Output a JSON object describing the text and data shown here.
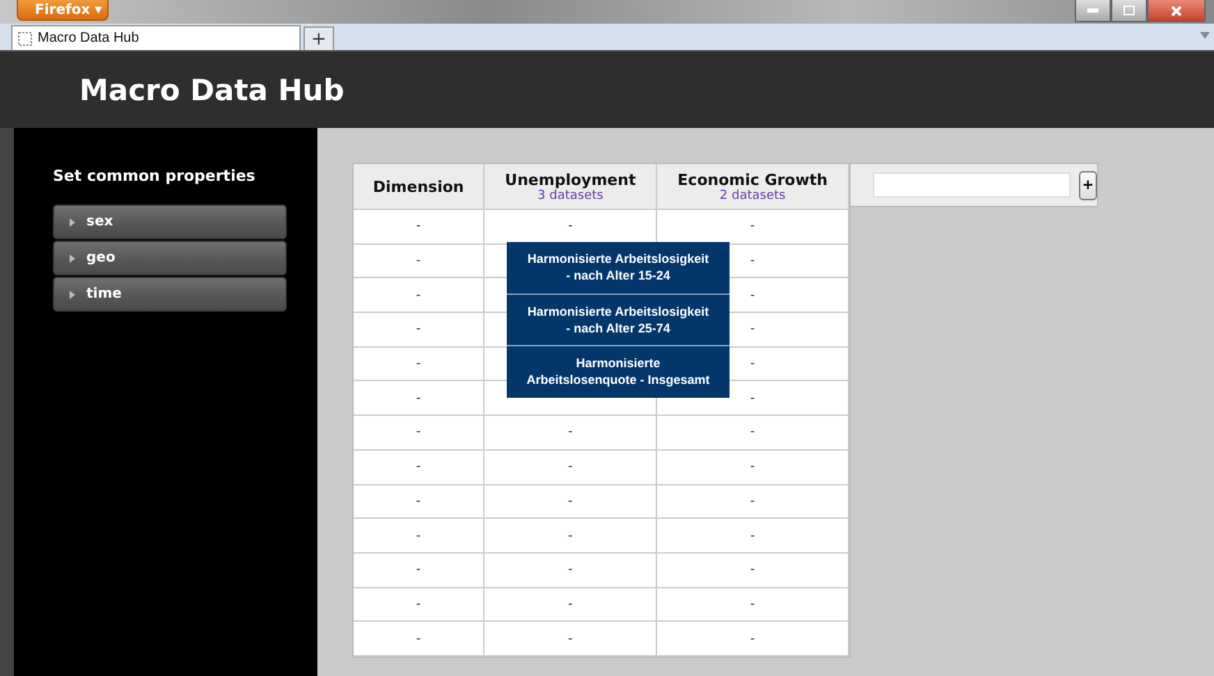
{
  "browser": {
    "menu_button": "Firefox ▾",
    "tab": {
      "title": "Macro Data Hub",
      "selected": true
    },
    "new_tab": "+"
  },
  "header": {
    "title": "Macro Data Hub"
  },
  "sidebar": {
    "heading": "Set common properties",
    "items": [
      {
        "label": "sex",
        "expanded": false
      },
      {
        "label": "geo",
        "expanded": false
      },
      {
        "label": "time",
        "expanded": false
      }
    ]
  },
  "table": {
    "columns": [
      {
        "title": "Dimension"
      },
      {
        "title": "Unemployment",
        "subtitle": "3 datasets"
      },
      {
        "title": "Economic Growth",
        "subtitle": "2 datasets"
      }
    ],
    "add_column": {
      "button": "+"
    },
    "rows": [
      {
        "dimension": "-",
        "unemployment": "-",
        "growth": "-"
      },
      {
        "dimension": "-",
        "growth": "-"
      },
      {
        "dimension": "-",
        "growth": "-"
      },
      {
        "dimension": "-",
        "growth": "-"
      },
      {
        "dimension": "-",
        "growth": "-"
      },
      {
        "dimension": "-",
        "growth": "-"
      },
      {
        "dimension": "-",
        "unemployment": "-",
        "growth": "-"
      },
      {
        "dimension": "-",
        "unemployment": "-",
        "growth": "-"
      },
      {
        "dimension": "-",
        "unemployment": "-",
        "growth": "-"
      },
      {
        "dimension": "-",
        "unemployment": "-",
        "growth": "-"
      },
      {
        "dimension": "-",
        "unemployment": "-",
        "growth": "-"
      },
      {
        "dimension": "-",
        "unemployment": "-",
        "growth": "-"
      },
      {
        "dimension": "-",
        "unemployment": "-",
        "growth": "-"
      }
    ]
  },
  "dataset_menu": {
    "items": [
      "Harmonisierte Arbeitslosigkeit - nach Alter 15-24",
      "Harmonisierte Arbeitslosigkeit - nach Alter 25-74",
      "Harmonisierte Arbeitslosenquote - Insgesamt"
    ]
  }
}
